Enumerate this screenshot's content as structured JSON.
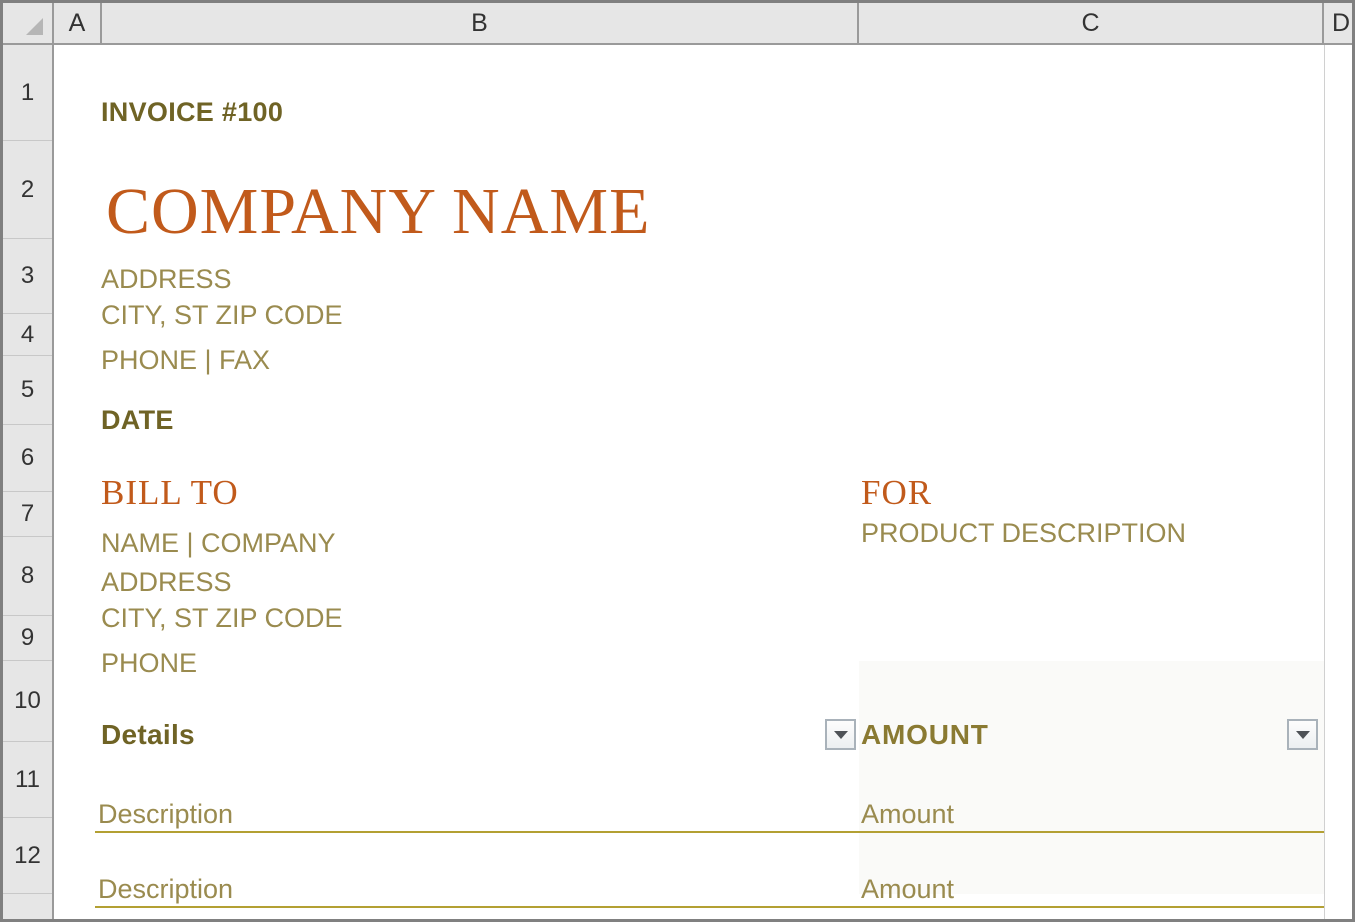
{
  "app": {
    "type": "spreadsheet",
    "columns": [
      "A",
      "B",
      "C",
      "D"
    ],
    "rows": [
      "1",
      "2",
      "3",
      "4",
      "5",
      "6",
      "7",
      "8",
      "9",
      "10",
      "11",
      "12"
    ]
  },
  "colors": {
    "accent_orange": "#C15A1B",
    "olive_heading": "#6F6325",
    "muted_olive_text": "#9A8B4F",
    "gold_rule": "#B3A033",
    "header_gray": "#E6E6E6",
    "column_c_fill": "#FAFAF8"
  },
  "invoice": {
    "number_label": "INVOICE #100",
    "company_name": "COMPANY NAME",
    "sender": {
      "address": "ADDRESS",
      "city_state_zip": "CITY, ST ZIP CODE",
      "phone_fax": "PHONE | FAX"
    },
    "date_label": "DATE",
    "bill_to": {
      "heading": "BILL TO",
      "name_company": "NAME | COMPANY",
      "address": "ADDRESS",
      "city_state_zip": "CITY, ST ZIP CODE",
      "phone": "PHONE"
    },
    "for": {
      "heading": "FOR",
      "product_description": "PRODUCT DESCRIPTION"
    },
    "table": {
      "headers": {
        "details": "Details",
        "amount": "AMOUNT"
      },
      "rows": [
        {
          "description": "Description",
          "amount": "Amount"
        },
        {
          "description": "Description",
          "amount": "Amount"
        }
      ]
    }
  },
  "icons": {
    "select_all": "select-all-triangle-icon",
    "filter_details": "filter-dropdown-icon",
    "filter_amount": "filter-dropdown-icon"
  }
}
